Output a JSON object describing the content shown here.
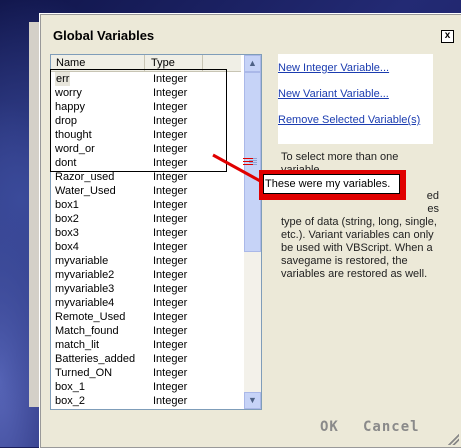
{
  "dialog": {
    "title": "Global Variables",
    "close_glyph": "x"
  },
  "list": {
    "columns": {
      "name": "Name",
      "type": "Type"
    },
    "rows": [
      {
        "name": "err",
        "type": "Integer"
      },
      {
        "name": "worry",
        "type": "Integer"
      },
      {
        "name": "happy",
        "type": "Integer"
      },
      {
        "name": "drop",
        "type": "Integer"
      },
      {
        "name": "thought",
        "type": "Integer"
      },
      {
        "name": "word_or",
        "type": "Integer"
      },
      {
        "name": "dont",
        "type": "Integer"
      },
      {
        "name": "Razor_used",
        "type": "Integer"
      },
      {
        "name": "Water_Used",
        "type": "Integer"
      },
      {
        "name": "box1",
        "type": "Integer"
      },
      {
        "name": "box2",
        "type": "Integer"
      },
      {
        "name": "box3",
        "type": "Integer"
      },
      {
        "name": "box4",
        "type": "Integer"
      },
      {
        "name": "myvariable",
        "type": "Integer"
      },
      {
        "name": "myvariable2",
        "type": "Integer"
      },
      {
        "name": "myvariable3",
        "type": "Integer"
      },
      {
        "name": "myvariable4",
        "type": "Integer"
      },
      {
        "name": "Remote_Used",
        "type": "Integer"
      },
      {
        "name": "Match_found",
        "type": "Integer"
      },
      {
        "name": "match_lit",
        "type": "Integer"
      },
      {
        "name": "Batteries_added",
        "type": "Integer"
      },
      {
        "name": "Turned_ON",
        "type": "Integer"
      },
      {
        "name": "box_1",
        "type": "Integer"
      },
      {
        "name": "box_2",
        "type": "Integer"
      }
    ]
  },
  "links": {
    "new_integer": "New Integer Variable...",
    "new_variant": "New Variant Variable...",
    "remove_selected": "Remove Selected Variable(s)"
  },
  "help": {
    "line1": "To select more than one variable,",
    "partial1": "ed",
    "partial2": "es",
    "line2": "type of data (string, long, single,",
    "line3": "etc.). Variant variables can only",
    "line4": "be used with VBScript.  When a",
    "line5": "savegame is restored, the",
    "line6": "variables are restored as well."
  },
  "annotation": {
    "text": "These were my variables.",
    "color": "#e00000"
  },
  "buttons": {
    "ok": "OK",
    "cancel": "Cancel"
  }
}
